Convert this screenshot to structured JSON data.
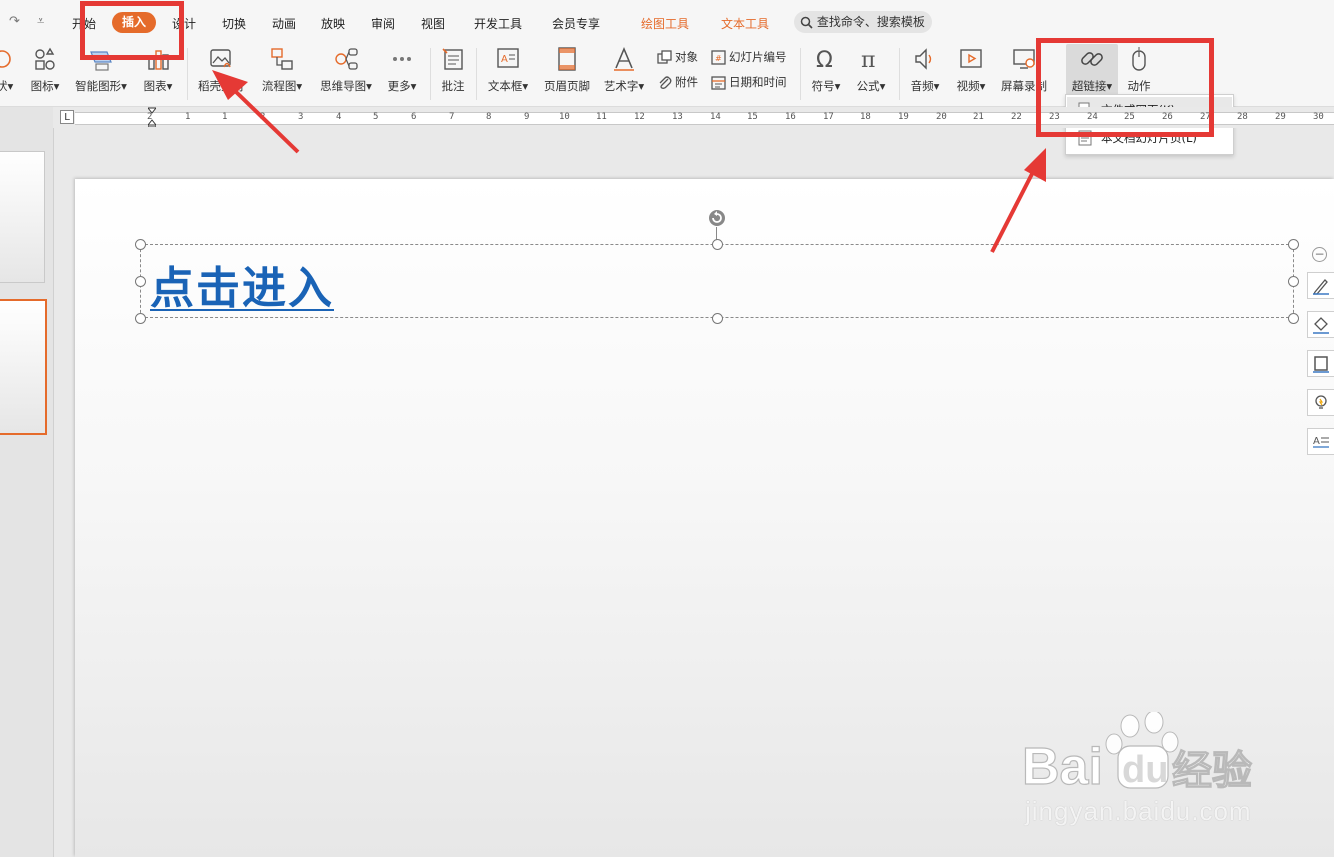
{
  "quick_access": {
    "redo_glyph": "↷",
    "customize_glyph": "⩡"
  },
  "menu_tabs": {
    "start": "开始",
    "insert": "插入",
    "design": "设计",
    "transition": "切换",
    "animation": "动画",
    "slideshow": "放映",
    "review": "审阅",
    "view": "视图",
    "developer": "开发工具",
    "member": "会员专享",
    "drawing_tools": "绘图工具",
    "text_tools": "文本工具",
    "search": "查找命令、搜索模板"
  },
  "ribbon": {
    "shapes": "状",
    "icons": "图标",
    "smartart": "智能图形",
    "chart": "图表",
    "material": "稻壳素材",
    "flowchart": "流程图",
    "mindmap": "思维导图",
    "more": "更多",
    "comment": "批注",
    "textbox": "文本框",
    "header_footer": "页眉页脚",
    "wordart": "艺术字",
    "object": "对象",
    "attachment": "附件",
    "slide_number": "幻灯片编号",
    "date_time": "日期和时间",
    "symbol": "符号",
    "formula": "公式",
    "audio": "音频",
    "video": "视频",
    "screen_record": "屏幕录制",
    "hyperlink": "超链接",
    "action": "动作",
    "dropdown_caret": "▾"
  },
  "hyperlink_menu": {
    "file_or_webpage": "文件或网页(K)",
    "this_document_slide": "本文档幻灯片页(L)"
  },
  "ruler": {
    "numbers": [
      "2",
      "1",
      "1",
      "2",
      "3",
      "4",
      "5",
      "6",
      "7",
      "8",
      "9",
      "10",
      "11",
      "12",
      "13",
      "14",
      "15",
      "16",
      "17",
      "18",
      "19",
      "20",
      "21",
      "22",
      "23",
      "24",
      "25",
      "26",
      "27",
      "28",
      "29",
      "30",
      "31"
    ],
    "corner": "L"
  },
  "slide": {
    "link_text": "点击进入"
  },
  "float_toolbar": {
    "collapse_glyph": "−"
  },
  "watermark": {
    "brand": "Baidu经验",
    "url": "jingyan.baidu.com"
  },
  "colors": {
    "accent_orange": "#e56b2b",
    "annotation_red": "#e53935",
    "link_blue": "#1a63b6"
  }
}
